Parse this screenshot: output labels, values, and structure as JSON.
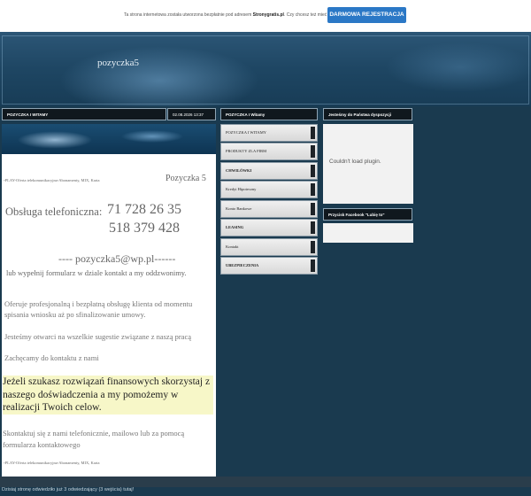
{
  "topbar": {
    "message_prefix": "Ta strona internetowa została utworzona bezpłatnie pod adresem ",
    "site_link": "Stronygratis.pl",
    "message_suffix": ". Czy chcesz też mieć własną stronę?",
    "register_button": "DARMOWA REJESTRACJA"
  },
  "header": {
    "site_title": "pozyczka5"
  },
  "main": {
    "section_title": "POZYCZKA I WITAMY",
    "date": "02.08.2026 13:37",
    "image_alt_top": "PLAY-Oferta telekomunikacyjna-Abonamenty, MIX, Karta",
    "heading": "Pozyczka 5",
    "phone_label": "Obsługa telefoniczna:",
    "phone1": "71 728 26 35",
    "phone2": "518 379 428",
    "email": "---- pozyczka5@wp.pl------",
    "form_note": "lub wypełnij formularz w dziale kontakt a my oddzwonimy.",
    "para1": "Oferuje profesjonalną i bezpłatną obsługę klienta od momentu spisania wniosku aż po sfinalizowanie umowy.",
    "para2": "Jesteśmy otwarci na wszelkie sugestie związane z naszą pracą",
    "para3": "Zachęcamy do kontaktu z nami",
    "highlight": "Jeżeli szukasz rozwiązań finansowych skorzystaj z naszego doświadczenia a my pomożemy w realizacji Twoich celow.",
    "para5": "Skontaktuj się z nami telefonicznie, mailowo lub za pomocą formularza kontaktowego",
    "image_alt_bottom": "PLAY-Oferta telekomunikacyjna-Abonamenty, MIX, Karta"
  },
  "menu": {
    "title": "POZYCZKA I Witamy",
    "items": [
      {
        "label": "POZYCZKA I WITAMY"
      },
      {
        "label": "PRODUKTY ZLA FIRM"
      },
      {
        "label": "CHWILÓWKI"
      },
      {
        "label": "Kredyt Hipoteczny"
      },
      {
        "label": "Konto Bankowe"
      },
      {
        "label": "LEASING"
      },
      {
        "label": "Kontakt"
      },
      {
        "label": "UBEZPIECZENIA"
      }
    ]
  },
  "sidebar": {
    "box1_title": "Jesteśmy do Państwa dyspozycji",
    "plugin_message": "Couldn't load plugin.",
    "box2_title": "Przycisk Facebook \"Lubię to\""
  },
  "footer": {
    "visitors": "Dzisiaj stronę odwiedziło już 3 odwiedzający (3 wejścia) tutaj!"
  }
}
